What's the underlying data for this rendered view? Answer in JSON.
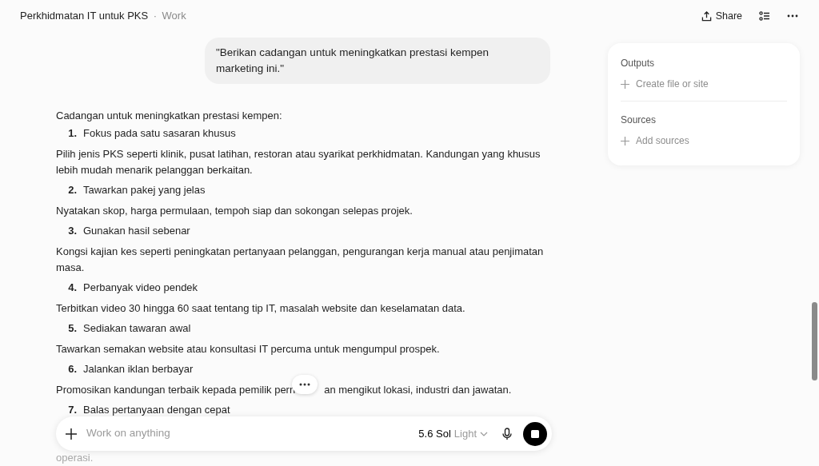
{
  "header": {
    "title": "Perkhidmatan IT untuk PKS",
    "separator": "·",
    "workspace": "Work",
    "share_label": "Share"
  },
  "prompt": "\"Berikan cadangan untuk meningkatkan prestasi kempen marketing ini.\"",
  "response": {
    "intro": "Cadangan untuk meningkatkan prestasi kempen:",
    "items": [
      {
        "number": "1.",
        "title": "Fokus pada satu sasaran khusus",
        "detail": [
          "Pilih jenis PKS seperti klinik, pusat latihan, restoran atau syarikat perkhidmatan. Kandungan yang khusus lebih mudah menarik pelanggan berkaitan."
        ]
      },
      {
        "number": "2.",
        "title": "Tawarkan pakej yang jelas",
        "detail": [
          "Nyatakan skop, harga permulaan, tempoh siap dan sokongan selepas projek."
        ]
      },
      {
        "number": "3.",
        "title": "Gunakan hasil sebenar",
        "detail": [
          "Kongsi kajian kes seperti peningkatan pertanyaan pelanggan, pengurangan kerja manual atau penjimatan masa."
        ]
      },
      {
        "number": "4.",
        "title": "Perbanyak video pendek",
        "detail": [
          "Terbitkan video 30 hingga 60 saat tentang tip IT, masalah website dan keselamatan data."
        ]
      },
      {
        "number": "5.",
        "title": "Sediakan tawaran awal",
        "detail": [
          "Tawarkan semakan website atau konsultasi IT percuma untuk mengumpul prospek."
        ]
      },
      {
        "number": "6.",
        "title": "Jalankan iklan berbayar",
        "detail": [
          "Promosikan kandungan terbaik kepada pemilik pern",
          "an mengikut lokasi, industri dan jawatan."
        ]
      },
      {
        "number": "7.",
        "title": "Balas pertanyaan dengan cepat"
      }
    ],
    "tail_text": "operasi."
  },
  "composer": {
    "placeholder": "Work on anything",
    "model": "5.6 Sol",
    "effort": "Light"
  },
  "side_panel": {
    "sections": [
      {
        "heading": "Outputs",
        "action": "Create file or site"
      },
      {
        "heading": "Sources",
        "action": "Add sources"
      }
    ]
  }
}
